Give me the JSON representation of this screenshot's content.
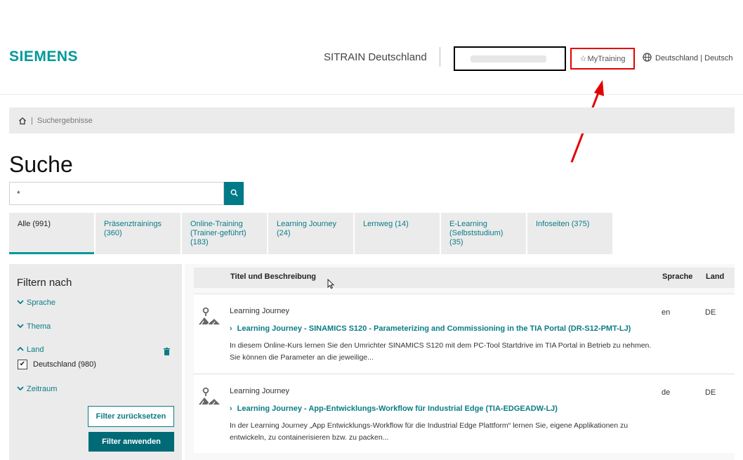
{
  "header": {
    "logo": "SIEMENS",
    "site_title": "SITRAIN Deutschland",
    "my_training": "MyTraining",
    "locale": "Deutschland | Deutsch"
  },
  "breadcrumb": {
    "current": "Suchergebnisse"
  },
  "page_title": "Suche",
  "search": {
    "value": "*"
  },
  "tabs": [
    {
      "label": "Alle (991)"
    },
    {
      "label": "Präsenztrainings (360)"
    },
    {
      "label": "Online-Training (Trainer-geführt) (183)"
    },
    {
      "label": "Learning Journey (24)"
    },
    {
      "label": "Lernweg (14)"
    },
    {
      "label": "E-Learning (Selbststudium) (35)"
    },
    {
      "label": "Infoseiten (375)"
    }
  ],
  "filters": {
    "title": "Filtern nach",
    "facets": [
      "Sprache",
      "Thema",
      "Land",
      "Zeitraum"
    ],
    "land_option": "Deutschland (980)",
    "reset_label": "Filter zurücksetzen",
    "apply_label": "Filter anwenden"
  },
  "results": {
    "columns": {
      "title": "Titel und Beschreibung",
      "language": "Sprache",
      "country": "Land"
    },
    "items": [
      {
        "category": "Learning Journey",
        "title": "Learning Journey - SINAMICS S120 - Parameterizing and Commissioning in the TIA Portal (DR-S12-PMT-LJ)",
        "description": "In diesem Online-Kurs lernen Sie den Umrichter SINAMICS S120 mit dem PC-Tool Startdrive im TIA Portal in Betrieb zu nehmen. Sie können die Parameter an die jeweilige...",
        "language": "en",
        "country": "DE"
      },
      {
        "category": "Learning Journey",
        "title": "Learning Journey - App-Entwicklungs-Workflow für Industrial Edge (TIA-EDGEADW-LJ)",
        "description": "In der Learning Journey „App Entwicklungs-Workflow für die Industrial Edge Plattform“ lernen Sie, eigene Applikationen zu entwickeln, zu containerisieren bzw. zu packen...",
        "language": "de",
        "country": "DE"
      }
    ]
  },
  "colors": {
    "accent": "#009999",
    "link": "#0a7c86",
    "highlight": "#e30000"
  }
}
